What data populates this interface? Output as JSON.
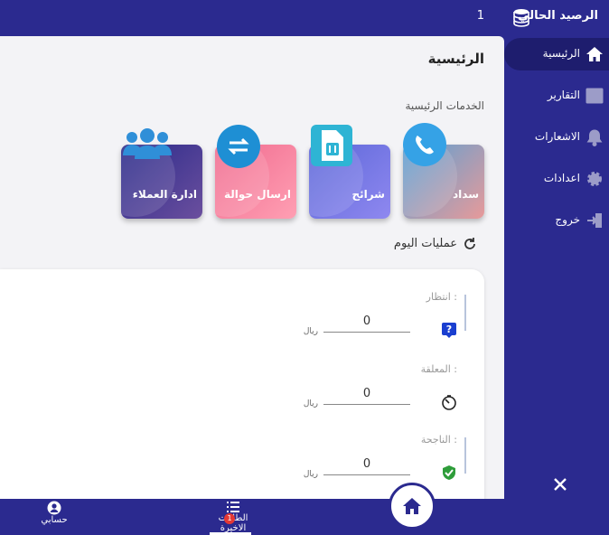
{
  "topbar": {
    "balance_label": "الرصيد الحالي",
    "balance_value": "1",
    "coins_icon": "coins-icon"
  },
  "sidebar": {
    "items": [
      {
        "label": "الرئيسية",
        "icon": "home-icon",
        "active": true
      },
      {
        "label": "التقارير",
        "icon": "bar-chart-icon",
        "active": false
      },
      {
        "label": "الاشعارات",
        "icon": "bell-icon",
        "active": false
      },
      {
        "label": "اعدادات",
        "icon": "gear-icon",
        "active": false
      },
      {
        "label": "خروج",
        "icon": "logout-icon",
        "active": false
      }
    ],
    "close_icon": "close-icon"
  },
  "main": {
    "title": "الرئيسية",
    "services_title": "الخدمات الرئيسية",
    "services": [
      {
        "label": "سداد",
        "icon": "phone-icon"
      },
      {
        "label": "شرائح",
        "icon": "sim-card-icon"
      },
      {
        "label": "ارسال حوالة",
        "icon": "transfer-icon"
      },
      {
        "label": "ادارة العملاء",
        "icon": "customers-icon"
      }
    ],
    "today_label": "عمليات اليوم",
    "stats": [
      {
        "label": "انتظار :",
        "value": "0",
        "unit": "ريال",
        "icon": "question-icon"
      },
      {
        "label": "المعلقة :",
        "value": "0",
        "unit": "ريال",
        "icon": "timer-icon"
      },
      {
        "label": "الناجحة :",
        "value": "0",
        "unit": "ريال",
        "icon": "check-icon"
      }
    ]
  },
  "bottombar": {
    "account_label": "حسابي",
    "requests_label": "الطلبات الاخيرة",
    "requests_badge": "1",
    "home_icon": "home-icon"
  },
  "colors": {
    "primary": "#2b2a8f",
    "active_nav": "#1e1d6e",
    "background": "#f3f3f6"
  }
}
